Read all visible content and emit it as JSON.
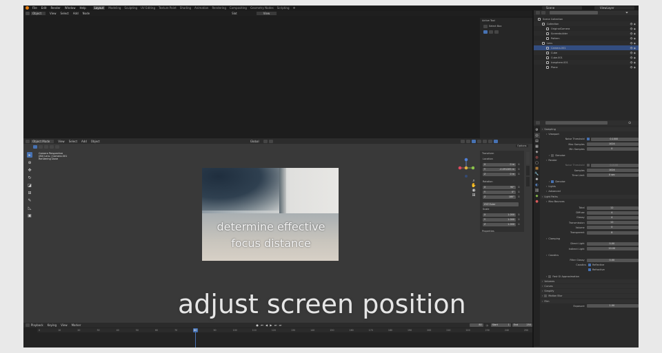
{
  "topbar": {
    "menus": [
      "File",
      "Edit",
      "Render",
      "Window",
      "Help"
    ],
    "workspaces": [
      "Layout",
      "Modeling",
      "Sculpting",
      "UV Editing",
      "Texture Paint",
      "Shading",
      "Animation",
      "Rendering",
      "Compositing",
      "Geometry Nodes",
      "Scripting"
    ],
    "scene": "Scene",
    "view_layer": "ViewLayer"
  },
  "upper_header": {
    "mode": "Object",
    "menus": [
      "View",
      "Select",
      "Add",
      "Node"
    ],
    "slot": "Slot",
    "view": "View"
  },
  "active_tool": {
    "title": "Active Tool",
    "item": "Select Box"
  },
  "viewport": {
    "mode": "Object Mode",
    "menus": [
      "View",
      "Select",
      "Add",
      "Object"
    ],
    "orientation": "Global",
    "overlay_lines": [
      "Camera Perspective",
      "(80) Lens | Camera.001",
      "Rendering Done"
    ],
    "options": "Options",
    "axis": {
      "x": "X",
      "y": "Y",
      "z": "Z"
    }
  },
  "subtitles": {
    "caption": "determine effective\nfocus distance",
    "main": "adjust screen position"
  },
  "transform": {
    "title": "Transform",
    "location_label": "Location",
    "location": [
      {
        "axis": "X",
        "val": "0 m"
      },
      {
        "axis": "Y",
        "val": "-0.091285 m"
      },
      {
        "axis": "Z",
        "val": "0 m"
      }
    ],
    "rotation_label": "Rotation",
    "rotation": [
      {
        "axis": "X",
        "val": "90°"
      },
      {
        "axis": "Y",
        "val": "0°"
      },
      {
        "axis": "Z",
        "val": "180°"
      }
    ],
    "rot_mode": "XYZ Euler",
    "scale_label": "Scale",
    "scale": [
      {
        "axis": "X",
        "val": "1.000"
      },
      {
        "axis": "Y",
        "val": "1.000"
      },
      {
        "axis": "Z",
        "val": "1.000"
      }
    ],
    "properties": "Properties"
  },
  "outliner": {
    "items": [
      {
        "label": "Scene Collection",
        "indent": 0
      },
      {
        "label": "Collection",
        "indent": 1
      },
      {
        "label": "OriginalCamera",
        "indent": 2
      },
      {
        "label": "Screenbuilder",
        "indent": 2
      },
      {
        "label": "Pattern",
        "indent": 2
      },
      {
        "label": "Lens",
        "indent": 1
      },
      {
        "label": "Camera.001",
        "indent": 2,
        "selected": true
      },
      {
        "label": "Cube",
        "indent": 2
      },
      {
        "label": "Cube.001",
        "indent": 2
      },
      {
        "label": "Icosphere.001",
        "indent": 2
      },
      {
        "label": "Plane",
        "indent": 2
      }
    ]
  },
  "properties": {
    "rows": [
      {
        "kind": "section",
        "label": "Sampling",
        "x": 0
      },
      {
        "kind": "section",
        "label": "Viewport",
        "x": 6
      },
      {
        "kind": "field",
        "label": "Noise Threshold",
        "value": "0.1000",
        "check": true
      },
      {
        "kind": "field",
        "label": "Max Samples",
        "value": "1024"
      },
      {
        "kind": "field",
        "label": "Min Samples",
        "value": "0"
      },
      {
        "kind": "gap"
      },
      {
        "kind": "section",
        "label": "Denoise",
        "x": 10,
        "check": false
      },
      {
        "kind": "section",
        "label": "Render",
        "x": 6
      },
      {
        "kind": "field",
        "label": "Noise Threshold",
        "value": "0.0100",
        "check": false,
        "dim": true
      },
      {
        "kind": "field",
        "label": "Samples",
        "value": "1024"
      },
      {
        "kind": "field",
        "label": "Time Limit",
        "value": "0 sec"
      },
      {
        "kind": "gap"
      },
      {
        "kind": "section",
        "label": "Denoise",
        "x": 10,
        "check": true
      },
      {
        "kind": "section",
        "label": "Lights",
        "x": 6
      },
      {
        "kind": "section",
        "label": "Advanced",
        "x": 6
      },
      {
        "kind": "section",
        "label": "Light Paths",
        "x": 0
      },
      {
        "kind": "section",
        "label": "Max Bounces",
        "x": 6
      },
      {
        "kind": "gap"
      },
      {
        "kind": "field",
        "label": "Total",
        "value": "12"
      },
      {
        "kind": "field",
        "label": "Diffuse",
        "value": "4"
      },
      {
        "kind": "field",
        "label": "Glossy",
        "value": "4"
      },
      {
        "kind": "field",
        "label": "Transmission",
        "value": "12"
      },
      {
        "kind": "field",
        "label": "Volume",
        "value": "0"
      },
      {
        "kind": "field",
        "label": "Transparent",
        "value": "8"
      },
      {
        "kind": "gap"
      },
      {
        "kind": "section",
        "label": "Clamping",
        "x": 6
      },
      {
        "kind": "field",
        "label": "Direct Light",
        "value": "0.00"
      },
      {
        "kind": "field",
        "label": "Indirect Light",
        "value": "10.00"
      },
      {
        "kind": "gap"
      },
      {
        "kind": "section",
        "label": "Caustics",
        "x": 6
      },
      {
        "kind": "field",
        "label": "Filter Glossy",
        "value": "0.00"
      },
      {
        "kind": "checkrow",
        "label": "Caustics",
        "value": "Reflective"
      },
      {
        "kind": "checkrow",
        "label": "",
        "value": "Refractive"
      },
      {
        "kind": "gap"
      },
      {
        "kind": "section",
        "label": "Fast GI Approximation",
        "x": 6,
        "check": false
      },
      {
        "kind": "section",
        "label": "Volumes",
        "x": 0
      },
      {
        "kind": "section",
        "label": "Curves",
        "x": 0
      },
      {
        "kind": "section",
        "label": "Simplify",
        "x": 0
      },
      {
        "kind": "section",
        "label": "Motion Blur",
        "x": 0,
        "check": false
      },
      {
        "kind": "section",
        "label": "Film",
        "x": 0
      },
      {
        "kind": "field",
        "label": "Exposure",
        "value": "1.00"
      }
    ]
  },
  "timeline": {
    "menus": [
      "Playback",
      "Keying",
      "View",
      "Marker"
    ],
    "current": "80",
    "start_label": "Start",
    "start": "1",
    "end_label": "End",
    "end": "250",
    "ticks": [
      "0",
      "10",
      "20",
      "30",
      "40",
      "50",
      "60",
      "70",
      "80",
      "90",
      "100",
      "110",
      "120",
      "130",
      "140",
      "150",
      "160",
      "170",
      "180",
      "190",
      "200",
      "210",
      "220",
      "230",
      "240",
      "250"
    ],
    "current_frame": 80,
    "frame_start": 0,
    "frame_end": 250
  },
  "colors": {
    "accent": "#4772b3",
    "selected_row": "#334d80",
    "bg": "#303030",
    "panel": "#2a2a2a",
    "header": "#1f1f1f"
  }
}
